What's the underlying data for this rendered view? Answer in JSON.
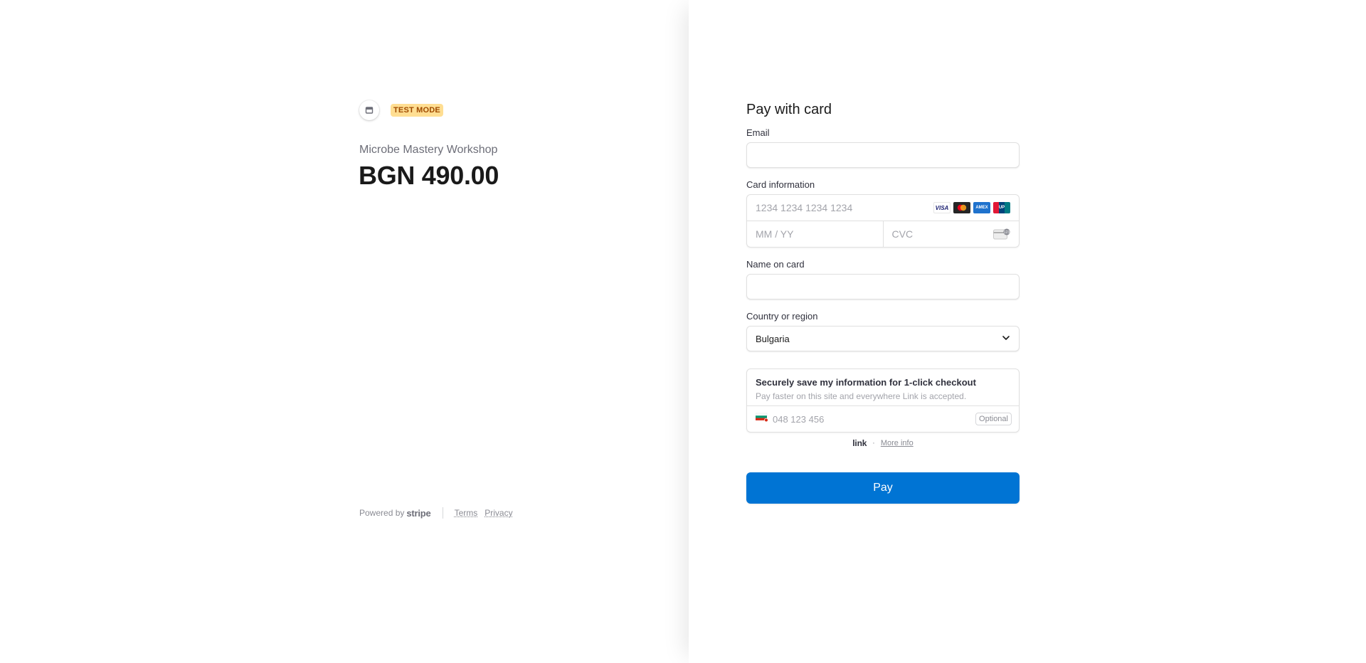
{
  "header": {
    "store_icon": "store-icon",
    "test_mode_label": "TEST MODE"
  },
  "product": {
    "name": "Microbe Mastery Workshop",
    "price": "BGN 490.00"
  },
  "footer": {
    "powered_by": "Powered by",
    "brand": "stripe",
    "terms": "Terms",
    "privacy": "Privacy"
  },
  "form": {
    "title": "Pay with card",
    "email_label": "Email",
    "email_value": "",
    "card_label": "Card information",
    "card_number_placeholder": "1234 1234 1234 1234",
    "card_brands": [
      "VISA",
      "mastercard",
      "amex",
      "unionpay"
    ],
    "expiry_placeholder": "MM / YY",
    "cvc_placeholder": "CVC",
    "name_label": "Name on card",
    "name_value": "",
    "country_label": "Country or region",
    "country_value": "Bulgaria",
    "pay_label": "Pay"
  },
  "link": {
    "title": "Securely save my information for 1-click checkout",
    "subtitle": "Pay faster on this site and everywhere Link is accepted.",
    "phone_placeholder": "048 123 456",
    "optional_label": "Optional",
    "logo": "link",
    "dot": "·",
    "more_info": "More info"
  },
  "colors": {
    "accent": "#0074d4",
    "badge_bg": "#ffde92",
    "badge_text": "#a04b00"
  }
}
